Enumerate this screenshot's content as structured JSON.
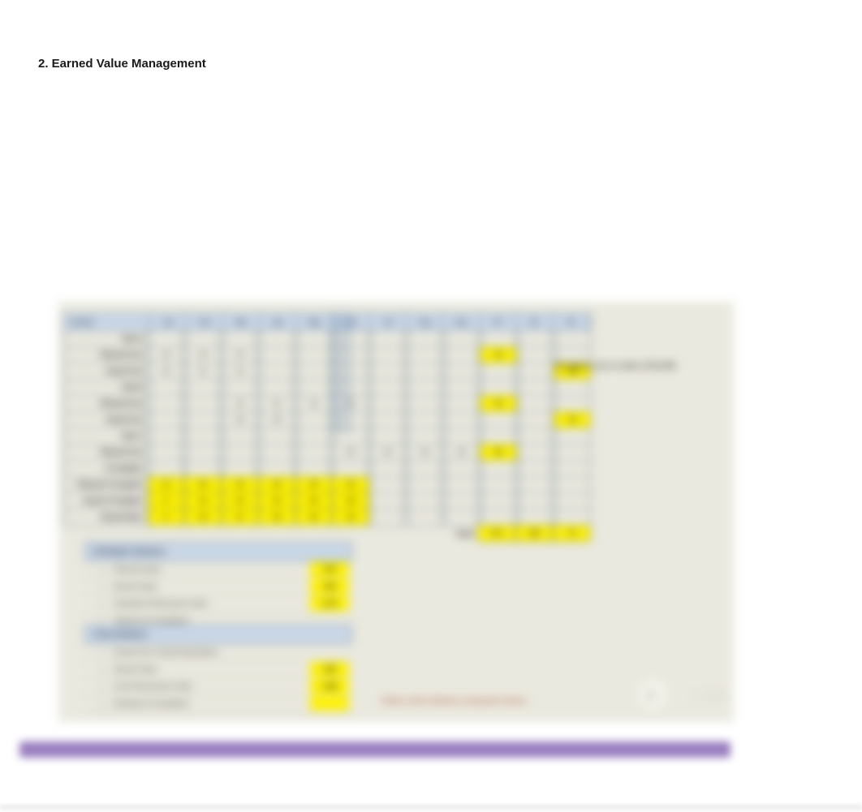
{
  "heading": "2. Earned Value Management",
  "top_table": {
    "headers": [
      "Activity",
      "Jan",
      "Feb",
      "Mar",
      "Apr",
      "May",
      "Jun",
      "Jul",
      "Aug",
      "Sep",
      "PV",
      "EV",
      "AC"
    ],
    "rows": [
      {
        "label": "Task A",
        "cells": [
          "",
          "",
          "",
          "",
          "",
          "",
          "",
          "",
          "",
          "",
          "",
          ""
        ]
      },
      {
        "label": "Planned Cost",
        "cells": [
          "10",
          "10",
          "10",
          "",
          "",
          "",
          "",
          "",
          "",
          "30",
          "",
          ""
        ],
        "hl": [
          9
        ]
      },
      {
        "label": "Actual Cost",
        "cells": [
          "12",
          "12",
          "12",
          "",
          "",
          "",
          "",
          "",
          "",
          "",
          "",
          "36"
        ],
        "hl": [
          11
        ]
      },
      {
        "label": "Task B",
        "cells": [
          "",
          "",
          "",
          "",
          "",
          "",
          "",
          "",
          "",
          "",
          "",
          ""
        ]
      },
      {
        "label": "Planned Cost",
        "cells": [
          "",
          "",
          "15",
          "15",
          "15",
          "15",
          "",
          "",
          "",
          "60",
          "",
          ""
        ],
        "hl": [
          9
        ]
      },
      {
        "label": "Actual Cost",
        "cells": [
          "",
          "",
          "18",
          "18",
          "",
          "",
          "",
          "",
          "",
          "",
          "",
          "36"
        ],
        "hl": [
          11
        ]
      },
      {
        "label": "Task C",
        "cells": [
          "",
          "",
          "",
          "",
          "",
          "",
          "",
          "",
          "",
          "",
          "",
          ""
        ]
      },
      {
        "label": "Planned Cost",
        "cells": [
          "",
          "",
          "",
          "",
          "",
          "20",
          "20",
          "20",
          "20",
          "80",
          "",
          ""
        ],
        "hl": [
          9
        ]
      },
      {
        "label": "% Complete",
        "cells": [
          "",
          "",
          "",
          "",
          "",
          "",
          "",
          "",
          "",
          "",
          "",
          ""
        ]
      },
      {
        "label": "Planned % Complete",
        "cells": [
          "10",
          "20",
          "30",
          "40",
          "50",
          "60",
          "",
          "",
          "",
          "",
          "",
          ""
        ],
        "ylw": [
          0,
          1,
          2,
          3,
          4,
          5
        ]
      },
      {
        "label": "Actual % Complete",
        "cells": [
          "8",
          "16",
          "24",
          "32",
          "40",
          "48",
          "",
          "",
          "",
          "",
          "",
          ""
        ],
        "ylw": [
          0,
          1,
          2,
          3,
          4,
          5
        ]
      },
      {
        "label": "Earned Value",
        "cells": [
          "9",
          "18",
          "27",
          "36",
          "45",
          "54",
          "",
          "",
          "",
          "",
          "",
          ""
        ],
        "ylw": [
          0,
          1,
          2,
          3,
          4,
          5
        ]
      }
    ],
    "totals_label": "Totals",
    "totals": [
      "170",
      "135",
      "72"
    ]
  },
  "right_note": "All values are in units of $1,000",
  "schedule": {
    "title": "Schedule Variance",
    "lines": [
      {
        "label": "Planned Value",
        "value": "170",
        "yl": true
      },
      {
        "label": "Earned Value",
        "value": "135",
        "yl": true
      },
      {
        "label": "Schedule Performance Index",
        "value": "0.79",
        "yl": true
      },
      {
        "label": "Variance at Completion",
        "value": "",
        "yl": false
      }
    ]
  },
  "cost": {
    "title": "Cost Variance",
    "lines": [
      {
        "label": "Actual Cost / Actual Expenditure",
        "value": "",
        "yl": false
      },
      {
        "label": "Earned Value",
        "value": "135",
        "yl": true
      },
      {
        "label": "Cost Performance Index",
        "value": "1.88",
        "yl": true
      },
      {
        "label": "Estimate at Completion",
        "value": "",
        "yl": true
      }
    ]
  },
  "caption": "Yellow cells indicate computed values",
  "footer_text": "1:09"
}
